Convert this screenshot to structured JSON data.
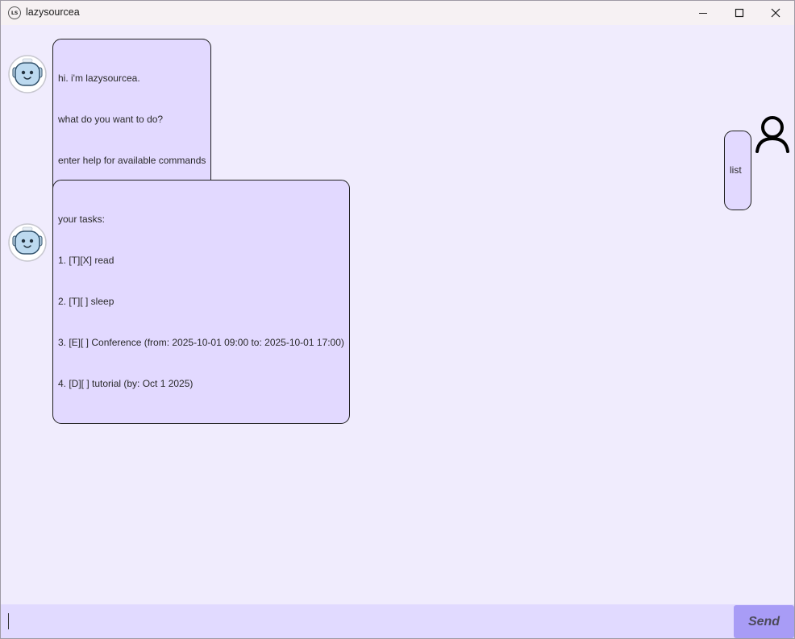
{
  "window": {
    "title": "lazysourcea",
    "icon_text": "LS"
  },
  "chat": {
    "messages": [
      {
        "sender": "bot",
        "lines": [
          "hi. i'm lazysourcea.",
          "what do you want to do?",
          "enter help for available commands"
        ]
      },
      {
        "sender": "user",
        "lines": [
          "list"
        ]
      },
      {
        "sender": "bot",
        "lines": [
          "your tasks:",
          "1. [T][X] read",
          "2. [T][ ] sleep",
          "3. [E][ ] Conference (from: 2025-10-01 09:00 to: 2025-10-01 17:00)",
          "4. [D][ ] tutorial (by: Oct 1 2025)"
        ]
      }
    ]
  },
  "input": {
    "value": "",
    "placeholder": ""
  },
  "send_button": {
    "label": "Send"
  },
  "colors": {
    "chat_background": "#f0ecfd",
    "bubble_fill": "#e2d9ff",
    "input_bar": "#e1daff",
    "send_button": "#a89cf6"
  }
}
